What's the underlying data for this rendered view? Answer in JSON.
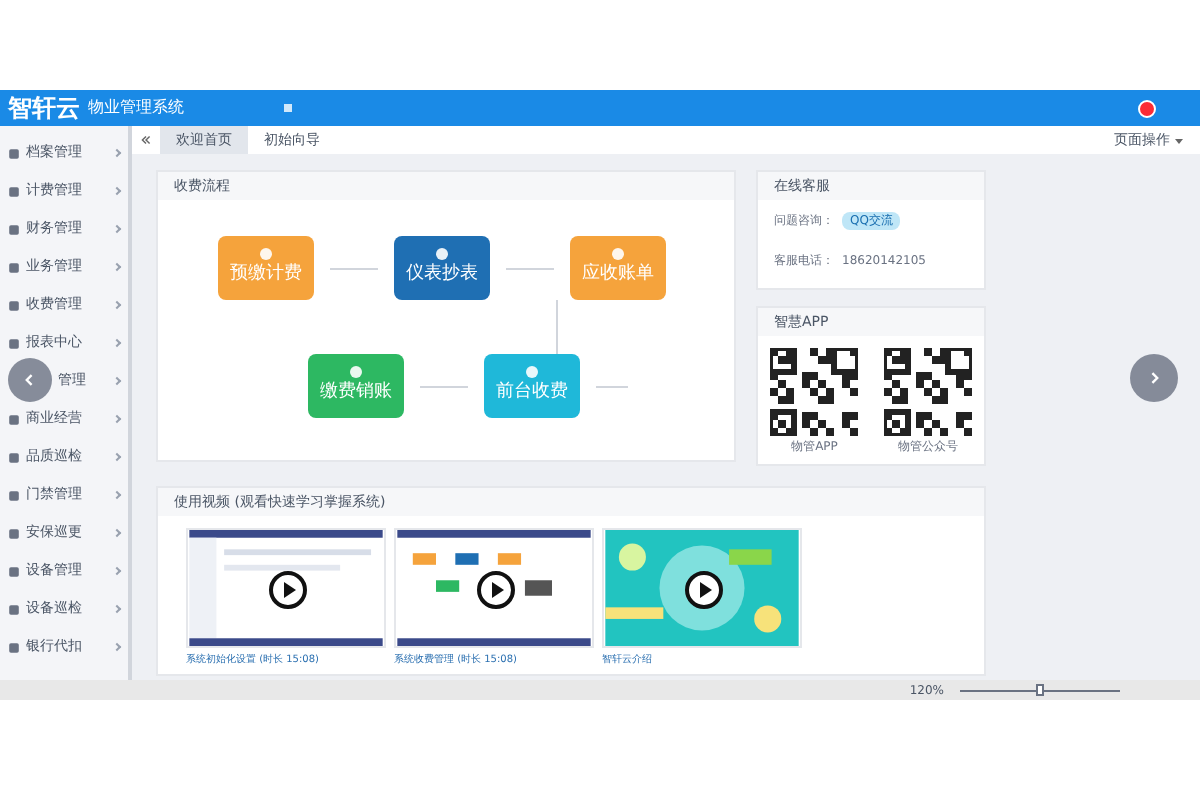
{
  "header": {
    "logo": "智轩云",
    "title": "物业管理系统"
  },
  "sidebar": {
    "items": [
      {
        "label": "档案管理",
        "covered": false
      },
      {
        "label": "计费管理",
        "covered": false
      },
      {
        "label": "财务管理",
        "covered": false
      },
      {
        "label": "业务管理",
        "covered": false
      },
      {
        "label": "收费管理",
        "covered": false
      },
      {
        "label": "报表中心",
        "covered": false
      },
      {
        "label": "管理",
        "covered": true
      },
      {
        "label": "商业经营",
        "covered": false
      },
      {
        "label": "品质巡检",
        "covered": false
      },
      {
        "label": "门禁管理",
        "covered": false
      },
      {
        "label": "安保巡更",
        "covered": false
      },
      {
        "label": "设备管理",
        "covered": false
      },
      {
        "label": "设备巡检",
        "covered": false
      },
      {
        "label": "银行代扣",
        "covered": false
      }
    ]
  },
  "tabs": [
    {
      "label": "欢迎首页",
      "selected": true
    },
    {
      "label": "初始向导",
      "selected": false
    }
  ],
  "page_actions": "页面操作",
  "flow": {
    "title": "收费流程",
    "steps": [
      {
        "label": "预缴计费",
        "color": "#f5a33c"
      },
      {
        "label": "仪表抄表",
        "color": "#1f6fb3"
      },
      {
        "label": "应收账单",
        "color": "#f5a33c"
      },
      {
        "label": "前台收费",
        "color": "#1fb8d9"
      },
      {
        "label": "缴费销账",
        "color": "#2db862"
      }
    ]
  },
  "help": {
    "title": "在线客服",
    "rows": [
      {
        "label": "问题咨询：",
        "value": "QQ交流",
        "kind": "badge"
      },
      {
        "label": "客服电话：",
        "value": "18620142105",
        "kind": "text"
      }
    ]
  },
  "app": {
    "title": "智慧APP",
    "codes": [
      {
        "caption": "物管APP"
      },
      {
        "caption": "物管公众号"
      }
    ]
  },
  "videos": {
    "title": "使用视频 (观看快速学习掌握系统)",
    "items": [
      {
        "caption": "系统初始化设置 (时长 15:08)",
        "kind": "table"
      },
      {
        "caption": "系统收费管理 (时长 15:08)",
        "kind": "flow"
      },
      {
        "caption": "智轩云介绍",
        "kind": "promo"
      }
    ]
  },
  "status_bar": {
    "zoom": "120%",
    "zoom_slider": {
      "level": 0.5
    }
  }
}
